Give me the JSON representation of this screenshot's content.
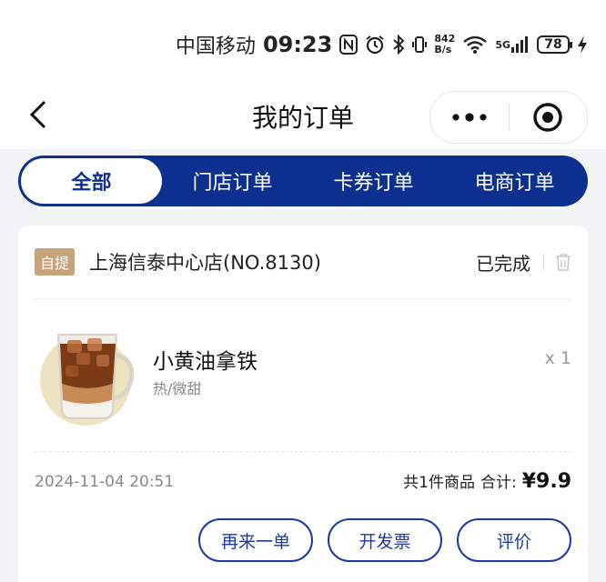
{
  "status_bar": {
    "carrier": "中国移动",
    "time": "09:23",
    "net_speed_value": "842",
    "net_speed_unit": "B/s",
    "signal_label": "5G",
    "battery": "78"
  },
  "nav": {
    "title": "我的订单"
  },
  "tabs": [
    {
      "label": "全部",
      "active": true
    },
    {
      "label": "门店订单",
      "active": false
    },
    {
      "label": "卡券订单",
      "active": false
    },
    {
      "label": "电商订单",
      "active": false
    }
  ],
  "order": {
    "badge": "自提",
    "store": "上海信泰中心店(NO.8130)",
    "status": "已完成",
    "product": {
      "name": "小黄油拿铁",
      "spec": "热/微甜",
      "qty": "x 1"
    },
    "time": "2024-11-04 20:51",
    "count_text": "共1件商品",
    "total_label": "合计:",
    "total_amount": "¥9.9",
    "actions": [
      "再来一单",
      "开发票",
      "评价"
    ]
  },
  "colors": {
    "brand_blue": "#0d2f8f",
    "button_blue": "#1a3aa0",
    "badge_gold": "#c7a37a"
  }
}
